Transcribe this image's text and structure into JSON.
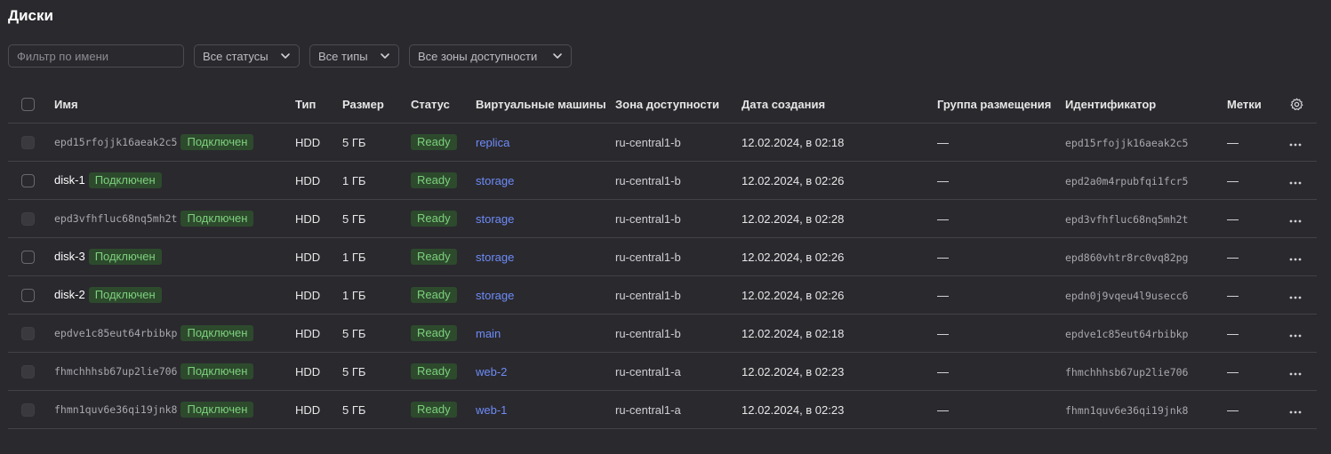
{
  "page": {
    "title": "Диски"
  },
  "filters": {
    "name_placeholder": "Фильтр по имени",
    "status": "Все статусы",
    "types": "Все типы",
    "zones": "Все зоны доступности"
  },
  "columns": {
    "name": "Имя",
    "type": "Тип",
    "size": "Размер",
    "status": "Статус",
    "vms": "Виртуальные машины",
    "zone": "Зона доступности",
    "created": "Дата создания",
    "placement": "Группа размещения",
    "id": "Идентификатор",
    "labels": "Метки"
  },
  "rows": [
    {
      "name": "epd15rfojjk16aeak2c5",
      "name_is_id": true,
      "attached": "Подключен",
      "type": "HDD",
      "size": "5 ГБ",
      "status": "Ready",
      "vm": "replica",
      "zone": "ru-central1-b",
      "created": "12.02.2024, в 02:18",
      "placement": "—",
      "id": "epd15rfojjk16aeak2c5",
      "labels": "—"
    },
    {
      "name": "disk-1",
      "name_is_id": false,
      "attached": "Подключен",
      "type": "HDD",
      "size": "1 ГБ",
      "status": "Ready",
      "vm": "storage",
      "zone": "ru-central1-b",
      "created": "12.02.2024, в 02:26",
      "placement": "—",
      "id": "epd2a0m4rpubfqi1fcr5",
      "labels": "—"
    },
    {
      "name": "epd3vfhfluc68nq5mh2t",
      "name_is_id": true,
      "attached": "Подключен",
      "type": "HDD",
      "size": "5 ГБ",
      "status": "Ready",
      "vm": "storage",
      "zone": "ru-central1-b",
      "created": "12.02.2024, в 02:28",
      "placement": "—",
      "id": "epd3vfhfluc68nq5mh2t",
      "labels": "—"
    },
    {
      "name": "disk-3",
      "name_is_id": false,
      "attached": "Подключен",
      "type": "HDD",
      "size": "1 ГБ",
      "status": "Ready",
      "vm": "storage",
      "zone": "ru-central1-b",
      "created": "12.02.2024, в 02:26",
      "placement": "—",
      "id": "epd860vhtr8rc0vq82pg",
      "labels": "—"
    },
    {
      "name": "disk-2",
      "name_is_id": false,
      "attached": "Подключен",
      "type": "HDD",
      "size": "1 ГБ",
      "status": "Ready",
      "vm": "storage",
      "zone": "ru-central1-b",
      "created": "12.02.2024, в 02:26",
      "placement": "—",
      "id": "epdn0j9vqeu4l9usecc6",
      "labels": "—"
    },
    {
      "name": "epdve1c85eut64rbibkp",
      "name_is_id": true,
      "attached": "Подключен",
      "type": "HDD",
      "size": "5 ГБ",
      "status": "Ready",
      "vm": "main",
      "zone": "ru-central1-b",
      "created": "12.02.2024, в 02:18",
      "placement": "—",
      "id": "epdve1c85eut64rbibkp",
      "labels": "—"
    },
    {
      "name": "fhmchhhsb67up2lie706",
      "name_is_id": true,
      "attached": "Подключен",
      "type": "HDD",
      "size": "5 ГБ",
      "status": "Ready",
      "vm": "web-2",
      "zone": "ru-central1-a",
      "created": "12.02.2024, в 02:23",
      "placement": "—",
      "id": "fhmchhhsb67up2lie706",
      "labels": "—"
    },
    {
      "name": "fhmn1quv6e36qi19jnk8",
      "name_is_id": true,
      "attached": "Подключен",
      "type": "HDD",
      "size": "5 ГБ",
      "status": "Ready",
      "vm": "web-1",
      "zone": "ru-central1-a",
      "created": "12.02.2024, в 02:23",
      "placement": "—",
      "id": "fhmn1quv6e36qi19jnk8",
      "labels": "—"
    }
  ],
  "icons": {
    "chevron": "chevron-down-icon",
    "settings": "gear-icon",
    "row_menu": "more-horizontal-icon"
  },
  "colors": {
    "background": "#2a292e",
    "badge_bg": "#2d4a2d",
    "badge_text": "#7dd07d",
    "link": "#6d8cf8"
  }
}
